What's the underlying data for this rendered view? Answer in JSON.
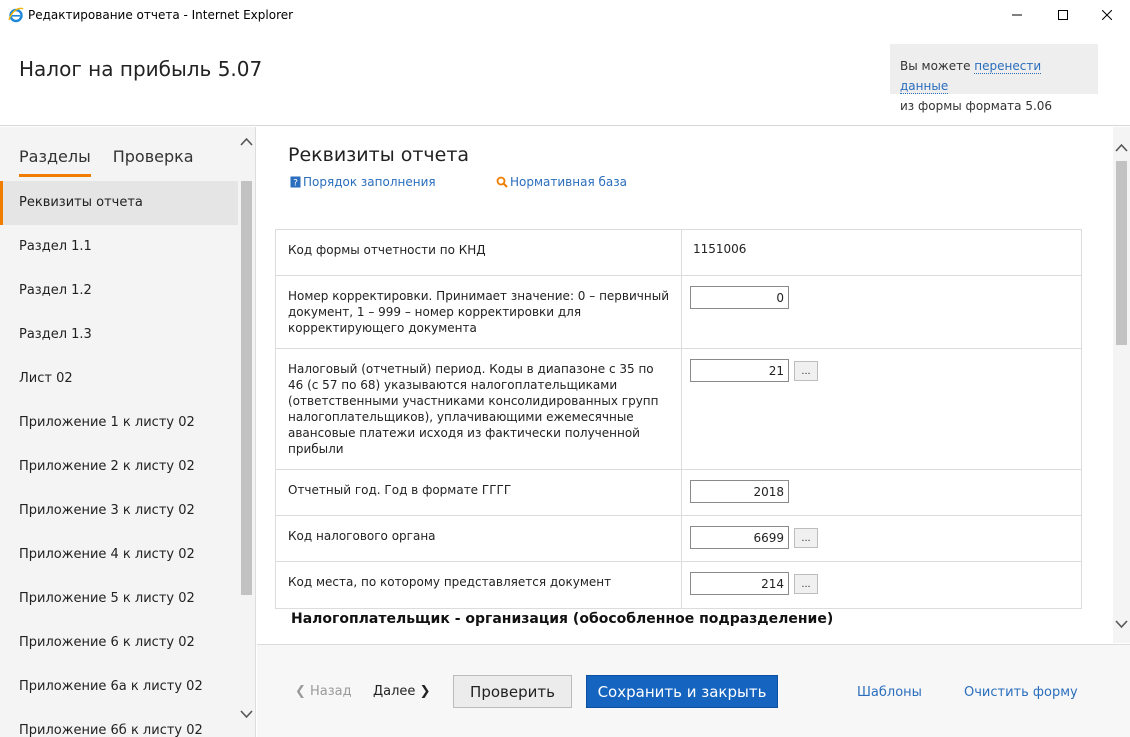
{
  "window": {
    "title": "Редактирование отчета - Internet Explorer"
  },
  "header": {
    "report_title": "Налог на прибыль 5.07",
    "notice_prefix": "Вы можете ",
    "notice_link": "перенести данные",
    "notice_suffix": "из формы формата 5.06"
  },
  "sidebar": {
    "tabs": [
      {
        "label": "Разделы",
        "active": true
      },
      {
        "label": "Проверка",
        "active": false
      }
    ],
    "items": [
      {
        "label": "Реквизиты отчета",
        "active": true
      },
      {
        "label": "Раздел 1.1"
      },
      {
        "label": "Раздел 1.2"
      },
      {
        "label": "Раздел 1.3"
      },
      {
        "label": "Лист 02"
      },
      {
        "label": "Приложение 1 к листу 02"
      },
      {
        "label": "Приложение 2 к листу 02"
      },
      {
        "label": "Приложение 3 к листу 02"
      },
      {
        "label": "Приложение 4 к листу 02"
      },
      {
        "label": "Приложение 5 к листу 02"
      },
      {
        "label": "Приложение 6 к листу 02"
      },
      {
        "label": "Приложение 6а к листу 02"
      },
      {
        "label": "Приложение 6б к листу 02"
      }
    ]
  },
  "main": {
    "section_title": "Реквизиты отчета",
    "link_fill_order": "Порядок заполнения",
    "link_normative": "Нормативная база",
    "fields": [
      {
        "label": "Код формы отчетности по КНД",
        "value": "1151006"
      },
      {
        "label": "Номер корректировки. Принимает значение: 0 – первичный документ, 1 – 999 – номер корректировки для корректирующего документа",
        "value": "0"
      },
      {
        "label": "Налоговый (отчетный) период. Коды в диапазоне с 35 по 46 (с 57 по 68) указываются налогоплательщиками (ответственными участниками консолидированных групп налогоплательщиков), уплачивающими ежемесячные авансовые платежи исходя из фактически полученной прибыли",
        "value": "21",
        "picker": "..."
      },
      {
        "label": "Отчетный год. Год в формате ГГГГ",
        "value": "2018"
      },
      {
        "label": "Код налогового органа",
        "value": "6699",
        "picker": "..."
      },
      {
        "label": "Код места, по которому представляется документ",
        "value": "214",
        "picker": "..."
      }
    ],
    "subheading": "Налогоплательщик - организация (обособленное подразделение)"
  },
  "footer": {
    "back_label": "Назад",
    "next_label": "Далее",
    "check_label": "Проверить",
    "save_label": "Сохранить и закрыть",
    "templates_label": "Шаблоны",
    "clear_label": "Очистить форму"
  },
  "colors": {
    "accent": "#f07d00",
    "primary_button": "#1565c0",
    "link": "#2a6ebd"
  }
}
